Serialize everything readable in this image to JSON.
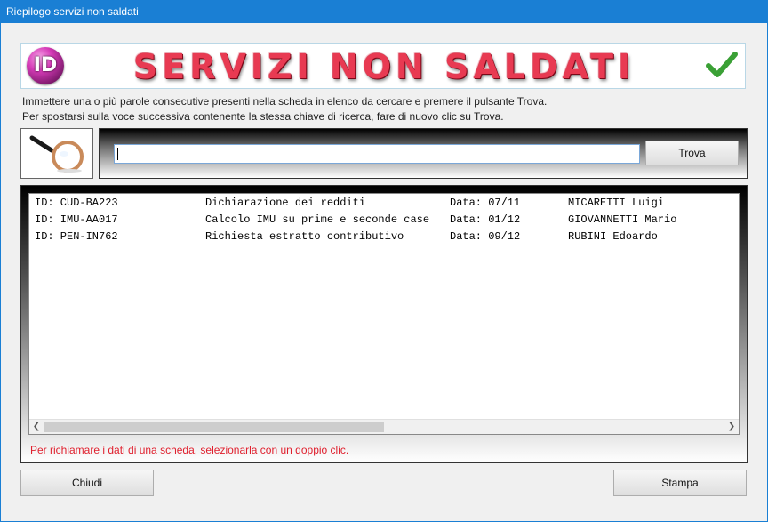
{
  "window": {
    "title": "Riepilogo servizi non saldati"
  },
  "banner": {
    "logo_text": "ID",
    "title": "SERVIZI NON SALDATI",
    "check_color": "#3aa035"
  },
  "instructions": {
    "line1": "Immettere una o più parole consecutive presenti nella scheda in elenco da cercare e premere il pulsante Trova.",
    "line2": "Per spostarsi sulla voce successiva contenente la stessa chiave di ricerca, fare di nuovo clic su Trova."
  },
  "search": {
    "value": "",
    "button_label": "Trova"
  },
  "list": {
    "rows": [
      {
        "id": "ID: CUD-BA223",
        "service": "Dichiarazione dei redditi",
        "date": "Data: 07/11",
        "client": "MICARETTI Luigi"
      },
      {
        "id": "ID: IMU-AA017",
        "service": "Calcolo IMU su prime e seconde case",
        "date": "Data: 01/12",
        "client": "GIOVANNETTI Mario"
      },
      {
        "id": "ID: PEN-IN762",
        "service": "Richiesta estratto contributivo",
        "date": "Data: 09/12",
        "client": "RUBINI Edoardo"
      }
    ],
    "hint": "Per richiamare i dati di una scheda, selezionarla con un doppio clic."
  },
  "footer": {
    "close_label": "Chiudi",
    "print_label": "Stampa"
  },
  "colors": {
    "title_bar": "#1a7fd4",
    "banner_text": "#e83a52",
    "hint_text": "#e0202e"
  }
}
